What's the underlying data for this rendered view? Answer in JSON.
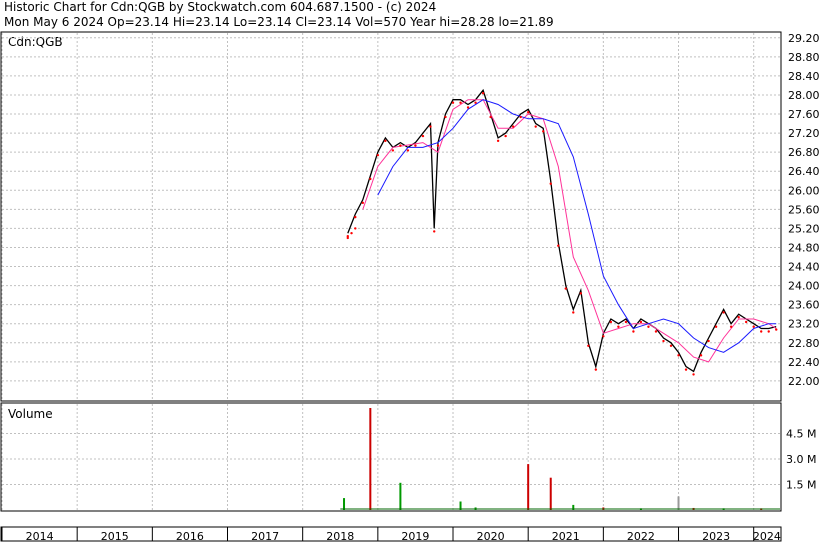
{
  "header": {
    "line1": "Historic Chart for Cdn:QGB by Stockwatch.com 604.687.1500 - (c) 2024",
    "line2": "Mon May  6 2024  Op=23.14  Hi=23.14  Lo=23.14  Cl=23.14  Vol=570  Year hi=28.28  lo=21.89"
  },
  "colors": {
    "price": "#000000",
    "ma_short": "#ff3399",
    "ma_long": "#1a1aff",
    "dots": "#ff0000",
    "volume_up": "#cc0000",
    "volume_down": "#009900",
    "volume_flat": "#999999",
    "grid": "#c0c0c0"
  },
  "chart_data": [
    {
      "type": "line",
      "title": "Cdn:QGB",
      "xlabel": "",
      "ylabel": "",
      "x_ticks": [
        "2014",
        "2015",
        "2016",
        "2017",
        "2018",
        "2019",
        "2020",
        "2021",
        "2022",
        "2023",
        "2024"
      ],
      "y_ticks": [
        "29.20",
        "28.80",
        "28.40",
        "28.00",
        "27.60",
        "27.20",
        "26.80",
        "26.40",
        "26.00",
        "25.60",
        "25.20",
        "24.80",
        "24.40",
        "24.00",
        "23.60",
        "23.20",
        "22.80",
        "22.40",
        "22.00"
      ],
      "ylim": [
        21.6,
        29.3
      ],
      "xlim": [
        2014.0,
        2024.35
      ],
      "grid": true,
      "series": [
        {
          "x": [
            2018.6,
            2018.7,
            2018.8,
            2018.9,
            2019.0,
            2019.1,
            2019.2,
            2019.3,
            2019.4,
            2019.5,
            2019.6,
            2019.7,
            2019.75,
            2019.8,
            2019.9,
            2020.0,
            2020.1,
            2020.2,
            2020.3,
            2020.4,
            2020.5,
            2020.6,
            2020.7,
            2020.8,
            2020.9,
            2021.0,
            2021.1,
            2021.2,
            2021.3,
            2021.4,
            2021.5,
            2021.6,
            2021.7,
            2021.8,
            2021.9,
            2022.0,
            2022.1,
            2022.2,
            2022.3,
            2022.4,
            2022.5,
            2022.6,
            2022.7,
            2022.8,
            2022.9,
            2023.0,
            2023.1,
            2023.2,
            2023.3,
            2023.4,
            2023.5,
            2023.6,
            2023.7,
            2023.8,
            2023.9,
            2024.0,
            2024.1,
            2024.2,
            2024.3
          ],
          "values": [
            25.1,
            25.5,
            25.8,
            26.3,
            26.8,
            27.1,
            26.9,
            27.0,
            26.9,
            27.0,
            27.2,
            27.4,
            25.2,
            27.0,
            27.6,
            27.9,
            27.9,
            27.8,
            27.9,
            28.1,
            27.6,
            27.1,
            27.2,
            27.4,
            27.6,
            27.7,
            27.4,
            27.3,
            26.2,
            24.9,
            24.0,
            23.5,
            23.9,
            22.8,
            22.3,
            23.0,
            23.3,
            23.2,
            23.3,
            23.1,
            23.3,
            23.2,
            23.1,
            22.9,
            22.8,
            22.6,
            22.3,
            22.2,
            22.6,
            22.9,
            23.2,
            23.5,
            23.2,
            23.4,
            23.3,
            23.2,
            23.1,
            23.1,
            23.14
          ]
        },
        {
          "name": "",
          "x": [
            2018.8,
            2019.0,
            2019.2,
            2019.4,
            2019.6,
            2019.8,
            2020.0,
            2020.2,
            2020.4,
            2020.6,
            2020.8,
            2021.0,
            2021.2,
            2021.4,
            2021.6,
            2021.8,
            2022.0,
            2022.2,
            2022.4,
            2022.6,
            2022.8,
            2023.0,
            2023.2,
            2023.4,
            2023.6,
            2023.8,
            2024.0,
            2024.2,
            2024.3
          ],
          "values": [
            25.6,
            26.5,
            26.9,
            26.95,
            27.0,
            26.8,
            27.7,
            27.9,
            27.9,
            27.3,
            27.3,
            27.6,
            27.5,
            26.5,
            24.6,
            23.9,
            23.0,
            23.1,
            23.2,
            23.2,
            23.0,
            22.8,
            22.5,
            22.4,
            22.9,
            23.3,
            23.3,
            23.2,
            23.1
          ]
        },
        {
          "name": "",
          "x": [
            2019.0,
            2019.2,
            2019.4,
            2019.6,
            2019.8,
            2020.0,
            2020.2,
            2020.4,
            2020.6,
            2020.8,
            2021.0,
            2021.2,
            2021.4,
            2021.6,
            2021.8,
            2022.0,
            2022.2,
            2022.4,
            2022.6,
            2022.8,
            2023.0,
            2023.2,
            2023.4,
            2023.6,
            2023.8,
            2024.0,
            2024.2,
            2024.3
          ],
          "values": [
            25.9,
            26.5,
            26.9,
            26.9,
            27.0,
            27.3,
            27.7,
            27.9,
            27.8,
            27.6,
            27.5,
            27.5,
            27.4,
            26.7,
            25.5,
            24.2,
            23.6,
            23.1,
            23.2,
            23.3,
            23.2,
            22.9,
            22.7,
            22.6,
            22.8,
            23.1,
            23.2,
            23.2
          ]
        }
      ],
      "dots": {
        "x": [
          2018.6,
          2018.65,
          2018.7
        ],
        "values": [
          25.0,
          25.1,
          25.2
        ]
      }
    },
    {
      "type": "bar",
      "title": "Volume",
      "xlabel": "",
      "ylabel": "",
      "y_ticks": [
        "4.5 M",
        "3.0 M",
        "1.5 M"
      ],
      "ylim": [
        0,
        6.0
      ],
      "bars": [
        {
          "x": 2018.55,
          "value": 0.7,
          "dir": "down"
        },
        {
          "x": 2018.9,
          "value": 6.0,
          "dir": "up"
        },
        {
          "x": 2019.3,
          "value": 1.6,
          "dir": "down"
        },
        {
          "x": 2020.1,
          "value": 0.5,
          "dir": "down"
        },
        {
          "x": 2020.3,
          "value": 0.15,
          "dir": "down"
        },
        {
          "x": 2021.0,
          "value": 2.7,
          "dir": "up"
        },
        {
          "x": 2021.3,
          "value": 1.9,
          "dir": "up"
        },
        {
          "x": 2021.6,
          "value": 0.3,
          "dir": "down"
        },
        {
          "x": 2022.0,
          "value": 0.15,
          "dir": "up"
        },
        {
          "x": 2022.5,
          "value": 0.1,
          "dir": "down"
        },
        {
          "x": 2023.0,
          "value": 0.8,
          "dir": "flat"
        },
        {
          "x": 2023.2,
          "value": 0.12,
          "dir": "up"
        },
        {
          "x": 2023.6,
          "value": 0.1,
          "dir": "down"
        },
        {
          "x": 2024.1,
          "value": 0.1,
          "dir": "up"
        }
      ]
    }
  ]
}
